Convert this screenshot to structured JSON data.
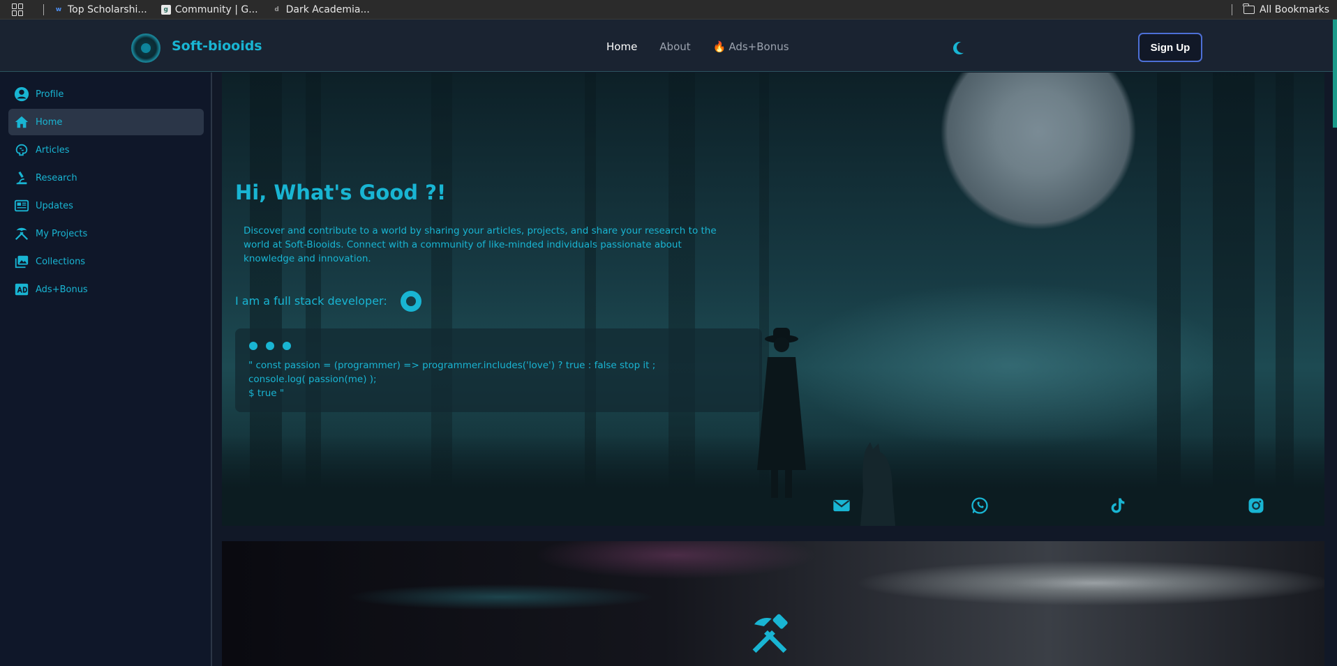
{
  "bookmarks": {
    "items": [
      {
        "label": "Top Scholarshi...",
        "fav": "w"
      },
      {
        "label": "Community | G...",
        "fav": "g"
      },
      {
        "label": "Dark Academia...",
        "fav": "d"
      }
    ],
    "all": "All Bookmarks"
  },
  "navbar": {
    "brand": "Soft-biooids",
    "links": [
      "Home",
      "About",
      "Ads+Bonus"
    ],
    "signup": "Sign Up"
  },
  "sidebar": {
    "items": [
      {
        "label": "Profile",
        "icon": "user-circle-icon"
      },
      {
        "label": "Home",
        "icon": "home-icon"
      },
      {
        "label": "Articles",
        "icon": "brain-icon"
      },
      {
        "label": "Research",
        "icon": "microscope-icon"
      },
      {
        "label": "Updates",
        "icon": "newspaper-icon"
      },
      {
        "label": "My Projects",
        "icon": "tools-icon"
      },
      {
        "label": "Collections",
        "icon": "images-icon"
      },
      {
        "label": "Ads+Bonus",
        "icon": "ad-icon"
      }
    ]
  },
  "hero": {
    "title": "Hi, What's Good ?!",
    "description": "Discover and contribute to a world by sharing your articles, projects, and share your research to the world at Soft-Biooids. Connect with a community of like-minded individuals passionate about knowledge and innovation.",
    "dev_line": "I am a full stack developer:",
    "code": [
      "\" const passion = (programmer) => programmer.includes('love') ? true : false stop it ;",
      "console.log( passion(me) );",
      "$ true \""
    ]
  },
  "colors": {
    "accent": "#19b5d3",
    "sidebar_bg": "#0f1729",
    "navbar_bg": "#1a2331"
  }
}
